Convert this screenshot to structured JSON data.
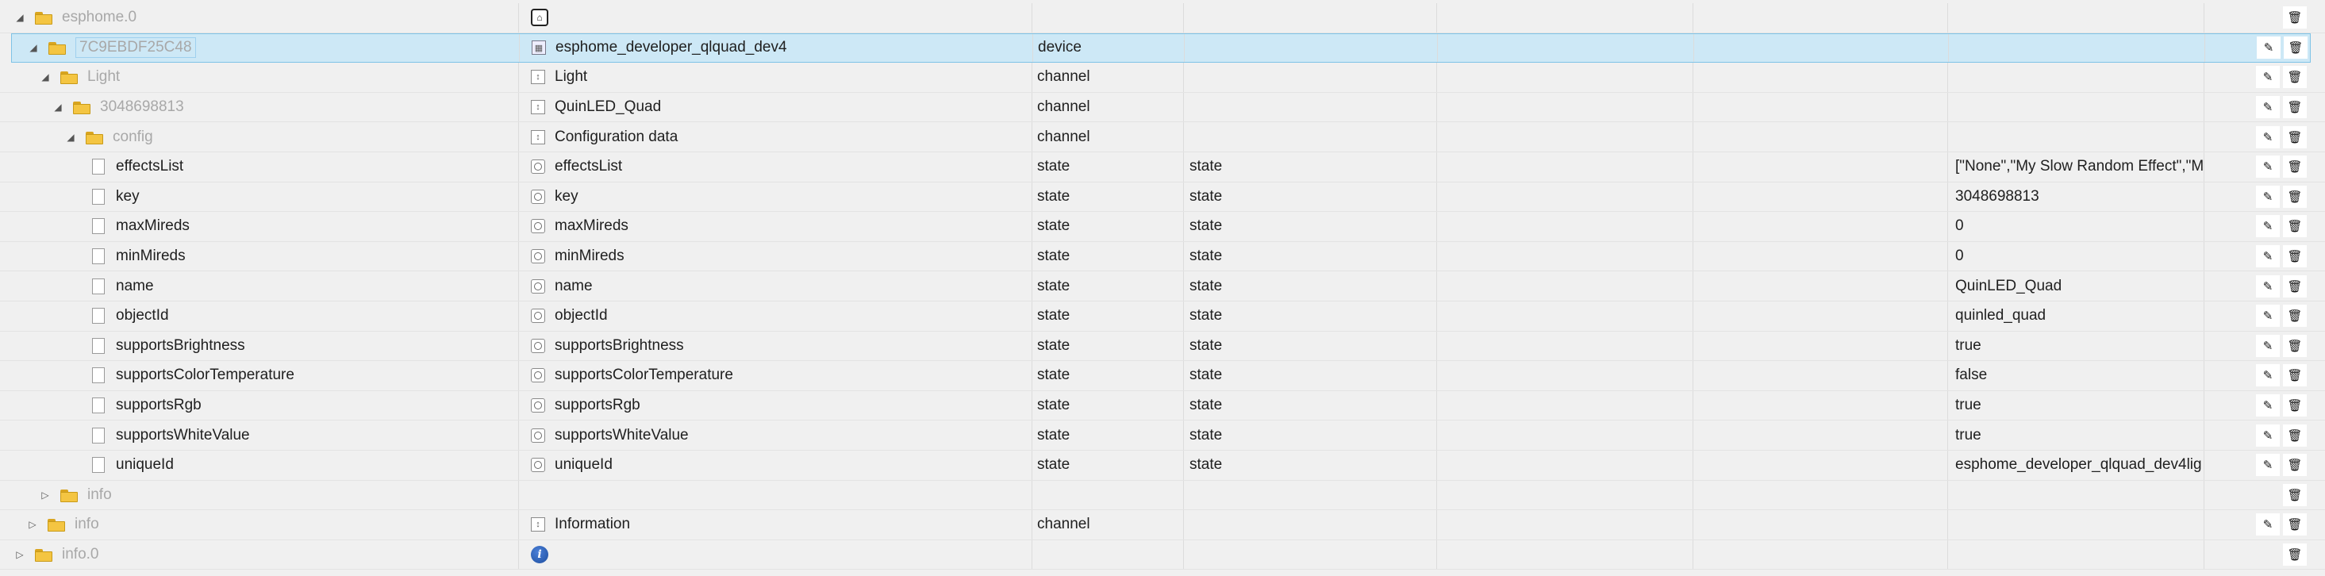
{
  "rows": [
    {
      "kind": "adapter",
      "toggle": "◢",
      "name": "esphome.0",
      "icon": "adapter-icon"
    },
    {
      "kind": "device",
      "toggle": "◢",
      "name": "7C9EBDF25C48",
      "desc": "esphome_developer_qlquad_dev4",
      "type": "device",
      "icon": "device-icon"
    },
    {
      "kind": "channel",
      "toggle": "◢",
      "name": "Light",
      "desc": "Light",
      "type": "channel",
      "icon": "channel-icon"
    },
    {
      "kind": "channel",
      "toggle": "◢",
      "name": "3048698813",
      "desc": "QuinLED_Quad",
      "type": "channel",
      "icon": "channel-icon"
    },
    {
      "kind": "channel",
      "toggle": "◢",
      "name": "config",
      "desc": "Configuration data",
      "type": "channel",
      "icon": "channel-icon"
    },
    {
      "kind": "state",
      "name": "effectsList",
      "desc": "effectsList",
      "type": "state",
      "role": "state",
      "value": "[\"None\",\"My Slow Random Effect\",\"M"
    },
    {
      "kind": "state",
      "name": "key",
      "desc": "key",
      "type": "state",
      "role": "state",
      "value": "3048698813"
    },
    {
      "kind": "state",
      "name": "maxMireds",
      "desc": "maxMireds",
      "type": "state",
      "role": "state",
      "value": "0"
    },
    {
      "kind": "state",
      "name": "minMireds",
      "desc": "minMireds",
      "type": "state",
      "role": "state",
      "value": "0"
    },
    {
      "kind": "state",
      "name": "name",
      "desc": "name",
      "type": "state",
      "role": "state",
      "value": "QuinLED_Quad"
    },
    {
      "kind": "state",
      "name": "objectId",
      "desc": "objectId",
      "type": "state",
      "role": "state",
      "value": "quinled_quad"
    },
    {
      "kind": "state",
      "name": "supportsBrightness",
      "desc": "supportsBrightness",
      "type": "state",
      "role": "state",
      "value": "true"
    },
    {
      "kind": "state",
      "name": "supportsColorTemperature",
      "desc": "supportsColorTemperature",
      "type": "state",
      "role": "state",
      "value": "false"
    },
    {
      "kind": "state",
      "name": "supportsRgb",
      "desc": "supportsRgb",
      "type": "state",
      "role": "state",
      "value": "true"
    },
    {
      "kind": "state",
      "name": "supportsWhiteValue",
      "desc": "supportsWhiteValue",
      "type": "state",
      "role": "state",
      "value": "true"
    },
    {
      "kind": "state",
      "name": "uniqueId",
      "desc": "uniqueId",
      "type": "state",
      "role": "state",
      "value": "esphome_developer_qlquad_dev4lig"
    },
    {
      "kind": "folder",
      "toggle": "▷",
      "name": "info"
    },
    {
      "kind": "channel",
      "toggle": "▷",
      "name": "info",
      "desc": "Information",
      "type": "channel",
      "icon": "channel-icon"
    },
    {
      "kind": "adapter",
      "toggle": "▷",
      "name": "info.0",
      "icon": "info-adapter-icon"
    }
  ],
  "icons": {
    "edit": "pencil-icon",
    "delete": "trash-icon"
  },
  "colors": {
    "selected_bg": "#cde8f6",
    "selected_border": "#7fc3e6",
    "folder": "#f4c542"
  }
}
